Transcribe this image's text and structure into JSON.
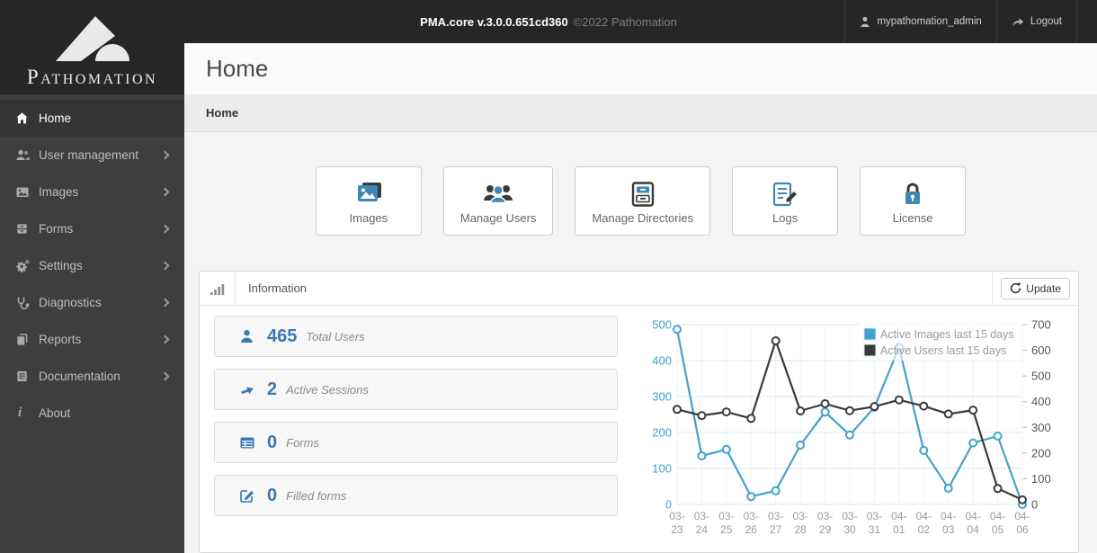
{
  "topbar": {
    "title_bold": "PMA.core v.3.0.0.651cd360",
    "title_muted": "©2022 Pathomation",
    "username": "mypathomation_admin",
    "logout_label": "Logout"
  },
  "brand": {
    "name": "Pathomation"
  },
  "sidebar": {
    "items": [
      {
        "label": "Home"
      },
      {
        "label": "User management"
      },
      {
        "label": "Images"
      },
      {
        "label": "Forms"
      },
      {
        "label": "Settings"
      },
      {
        "label": "Diagnostics"
      },
      {
        "label": "Reports"
      },
      {
        "label": "Documentation"
      },
      {
        "label": "About"
      }
    ]
  },
  "page": {
    "title": "Home",
    "breadcrumb": "Home"
  },
  "shortcuts": [
    {
      "label": "Images",
      "icon": "images-icon"
    },
    {
      "label": "Manage Users",
      "icon": "manage-users-icon"
    },
    {
      "label": "Manage Directories",
      "icon": "manage-directories-icon"
    },
    {
      "label": "Logs",
      "icon": "logs-icon"
    },
    {
      "label": "License",
      "icon": "license-icon"
    }
  ],
  "panel": {
    "title": "Information",
    "update_label": "Update"
  },
  "stats": [
    {
      "value": "465",
      "label": "Total Users",
      "icon": "user-icon"
    },
    {
      "value": "2",
      "label": "Active Sessions",
      "icon": "arrow-right-icon"
    },
    {
      "value": "0",
      "label": "Forms",
      "icon": "table-icon"
    },
    {
      "value": "0",
      "label": "Filled forms",
      "icon": "pencil-square-icon"
    }
  ],
  "colors": {
    "accent_blue": "#44a2cd",
    "stat_blue": "#3a79b4",
    "series_dark": "#3a3a3a",
    "grid_h": "#d9eaf5",
    "grid_v": "#f0f3f5",
    "tick_left": "#3ba0cc",
    "tick_right": "#555555",
    "x_label": "#9b9b9b"
  },
  "chart_data": {
    "type": "line",
    "categories": [
      "03-23",
      "03-24",
      "03-25",
      "03-26",
      "03-27",
      "03-28",
      "03-29",
      "03-30",
      "03-31",
      "04-01",
      "04-02",
      "04-03",
      "04-04",
      "04-05",
      "04-06"
    ],
    "series": [
      {
        "name": "Active Images last 15 days",
        "axis": "left",
        "color": "#44a2cd",
        "values": [
          487,
          135,
          153,
          22,
          38,
          165,
          257,
          193,
          270,
          437,
          150,
          45,
          171,
          190,
          0
        ]
      },
      {
        "name": "Active Users last 15 days",
        "axis": "right",
        "color": "#3a3a3a",
        "values": [
          370,
          346,
          360,
          335,
          637,
          364,
          392,
          365,
          381,
          407,
          383,
          352,
          367,
          62,
          18
        ]
      }
    ],
    "left_axis": {
      "min": 0,
      "max": 500,
      "step": 100
    },
    "right_axis": {
      "min": 0,
      "max": 700,
      "step": 100
    },
    "grid": true,
    "legend_position": "top-right"
  }
}
